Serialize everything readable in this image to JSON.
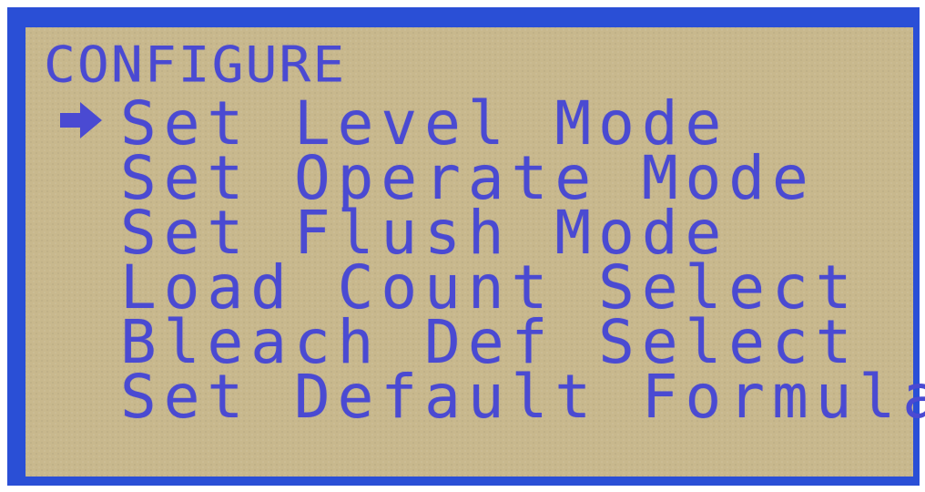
{
  "screen": {
    "title": "CONFIGURE",
    "cursor_icon": "arrow-right-icon",
    "colors": {
      "frame": "#2a4fd6",
      "lcd_background": "#c8b88d",
      "lcd_text": "#4a4ad2"
    },
    "menu": {
      "selected_index": 0,
      "items": [
        {
          "label": "Set Level Mode"
        },
        {
          "label": "Set Operate Mode"
        },
        {
          "label": "Set Flush Mode"
        },
        {
          "label": "Load Count Select"
        },
        {
          "label": "Bleach Def Select"
        },
        {
          "label": "Set Default Formula"
        }
      ]
    }
  }
}
